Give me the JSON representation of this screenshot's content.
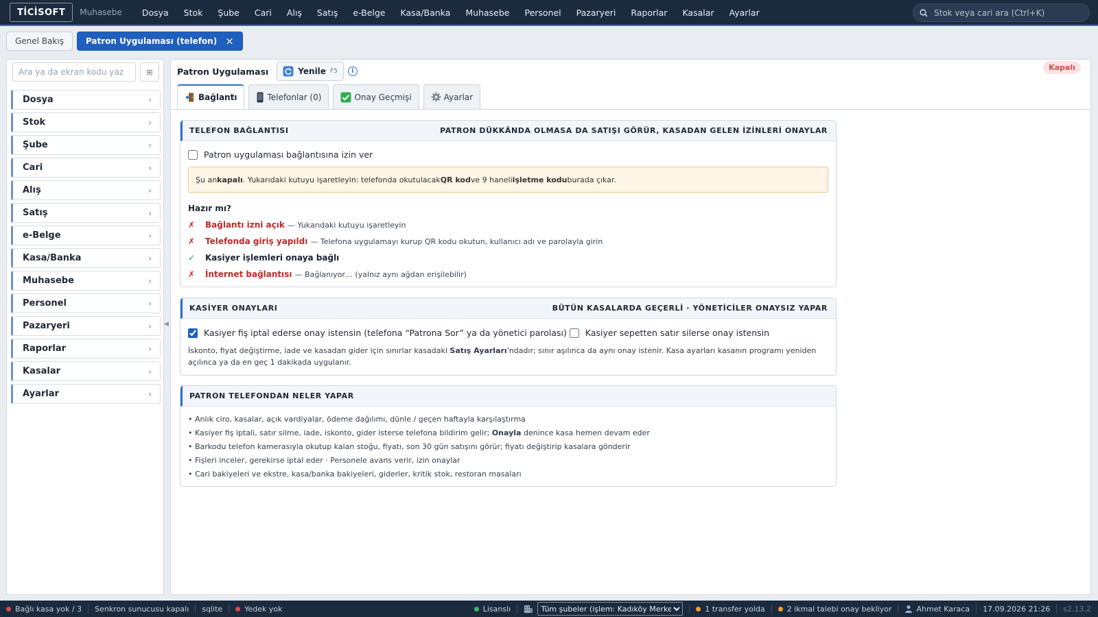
{
  "topbar": {
    "logo": "TİCİSOFT",
    "logo_sub": "Muhasebe",
    "menu": [
      "Dosya",
      "Stok",
      "Şube",
      "Cari",
      "Alış",
      "Satış",
      "e-Belge",
      "Kasa/Banka",
      "Muhasebe",
      "Personel",
      "Pazaryeri",
      "Raporlar",
      "Kasalar",
      "Ayarlar"
    ],
    "search_placeholder": "Stok veya cari ara (Ctrl+K)"
  },
  "tabs": [
    {
      "label": "Genel Bakış",
      "active": false
    },
    {
      "label": "Patron Uygulaması (telefon)",
      "active": true,
      "close": "×"
    }
  ],
  "sidebar": {
    "search_placeholder": "Ara ya da ekran kodu yaz",
    "grid_glyph": "⊞",
    "items": [
      "Dosya",
      "Stok",
      "Şube",
      "Cari",
      "Alış",
      "Satış",
      "e-Belge",
      "Kasa/Banka",
      "Muhasebe",
      "Personel",
      "Pazaryeri",
      "Raporlar",
      "Kasalar",
      "Ayarlar"
    ]
  },
  "toolbar": {
    "title": "Patron Uygulaması",
    "refresh_label": "Yenile",
    "refresh_key": "F5",
    "status": "Kapalı"
  },
  "subtabs": [
    {
      "label": "Bağlantı",
      "icon": "door-icon",
      "active": true
    },
    {
      "label": "Telefonlar (0)",
      "icon": "phone-icon",
      "active": false
    },
    {
      "label": "Onay Geçmişi",
      "icon": "check-box-icon",
      "active": false
    },
    {
      "label": "Ayarlar",
      "icon": "gear-icon",
      "active": false
    }
  ],
  "connection": {
    "title": "TELEFON BAĞLANTISI",
    "subtitle": "PATRON DÜKKÂNDA OLMASA DA SATIŞI GÖRÜR, KASADAN GELEN İZİNLERİ ONAYLAR",
    "allow_label": "Patron uygulaması bağlantısına izin ver",
    "allow_checked": false,
    "notice": {
      "p1": "Şu an ",
      "b1": "kapalı",
      "p2": ". Yukarıdaki kutuyu işaretleyin: telefonda okutulacak ",
      "b2": "QR kod",
      "p3": " ve 9 haneli ",
      "b3": "işletme kodu",
      "p4": " burada çıkar."
    },
    "ready_title": "Hazır mı?",
    "checks": [
      {
        "ok": false,
        "mark": "✗",
        "label": "Bağlantı izni açık",
        "desc": "— Yukarıdaki kutuyu işaretleyin"
      },
      {
        "ok": false,
        "mark": "✗",
        "label": "Telefonda giriş yapıldı",
        "desc": "— Telefona uygulamayı kurup QR kodu okutun, kullanıcı adı ve parolayla girin"
      },
      {
        "ok": true,
        "mark": "✓",
        "label": "Kasiyer işlemleri onaya bağlı",
        "desc": ""
      },
      {
        "ok": false,
        "mark": "✗",
        "label": "İnternet bağlantısı",
        "desc": "— Bağlanıyor… (yalnız aynı ağdan erişilebilir)"
      }
    ]
  },
  "approvals": {
    "title": "KASİYER ONAYLARI",
    "subtitle": "BÜTÜN KASALARDA GEÇERLİ · YÖNETİCİLER ONAYSIZ YAPAR",
    "opt1_label": "Kasiyer fiş iptal ederse onay istensin (telefona “Patrona Sor” ya da yönetici parolası)",
    "opt1_checked": true,
    "opt2_label": "Kasiyer sepetten satır silerse onay istensin",
    "opt2_checked": false,
    "note_p1": "İskonto, fiyat değiştirme, iade ve kasadan gider için sınırlar kasadaki ",
    "note_b": "Satış Ayarları",
    "note_p2": "'ndadır; sınır aşılınca da aynı onay istenir. Kasa ayarları kasanın programı yeniden açılınca ya da en geç 1 dakikada uygulanır."
  },
  "features": {
    "title": "PATRON TELEFONDAN NELER YAPAR",
    "b1": "• Anlık ciro, kasalar, açık vardiyalar, ödeme dağılımı, dünle / geçen haftayla karşılaştırma",
    "b2_p1": "• Kasiyer fiş iptali, satır silme, iade, iskonto, gider isterse telefona bildirim gelir; ",
    "b2_b": "Onayla",
    "b2_p2": " denince kasa hemen devam eder",
    "b3": "• Barkodu telefon kamerasıyla okutup kalan stoğu, fiyatı, son 30 gün satışını görür; fiyatı değiştirip kasalara gönderir",
    "b4": "• Fişleri inceler, gerekirse iptal eder · Personele avans verir, izin onaylar",
    "b5": "• Cari bakiyeleri ve ekstre, kasa/banka bakiyeleri, giderler, kritik stok, restoran masaları"
  },
  "statusbar": {
    "cash": "Bağlı kasa yok / 3",
    "sync": "Senkron sunucusu kapalı",
    "db": "sqlite",
    "backup": "Yedek yok",
    "license": "Lisanslı",
    "branch": "Tüm şubeler (işlem: Kadıköy Merkez)",
    "transfer": "1 transfer yolda",
    "supply": "2 ikmal talebi onay bekliyor",
    "user": "Ahmet Karaca",
    "datetime": "17.09.2026 21:26",
    "version": "s2.13.2"
  },
  "colors": {
    "accent": "#1f5fbf",
    "topbar": "#1c2a3e",
    "error": "#c62828",
    "success": "#1f9c4a"
  }
}
